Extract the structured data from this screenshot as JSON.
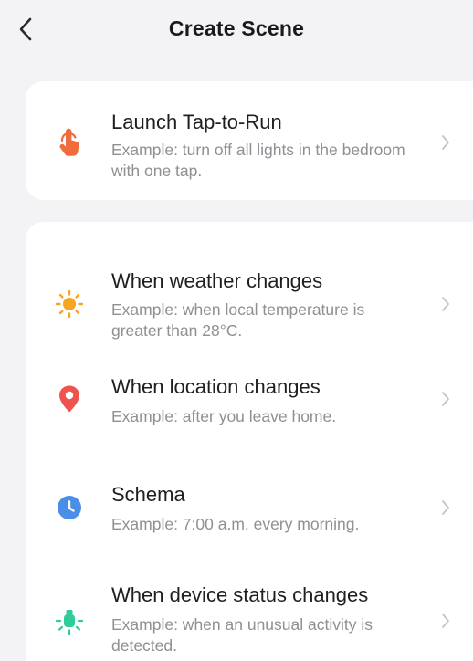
{
  "header": {
    "title": "Create Scene",
    "back_icon": "chevron-left-icon"
  },
  "card_tap": {
    "items": [
      {
        "title": "Launch Tap-to-Run",
        "desc": "Example: turn off all lights in the bedroom with one tap.",
        "icon": "tap-hand-icon",
        "color": "#f26b3a"
      }
    ]
  },
  "card_auto": {
    "items": [
      {
        "title": "When weather changes",
        "desc": "Example: when local temperature is greater than 28°C.",
        "icon": "sun-icon",
        "color": "#f6a623"
      },
      {
        "title": "When location changes",
        "desc": "Example: after you leave home.",
        "icon": "location-pin-icon",
        "color": "#ef5350"
      },
      {
        "title": "Schema",
        "desc": "Example: 7:00 a.m. every morning.",
        "icon": "clock-icon",
        "color": "#4a8fe7"
      },
      {
        "title": "When device status changes",
        "desc": "Example: when an unusual activity is detected.",
        "icon": "device-bulb-icon",
        "color": "#2ecc9a"
      }
    ]
  },
  "chevron_icon": "chevron-right-icon"
}
